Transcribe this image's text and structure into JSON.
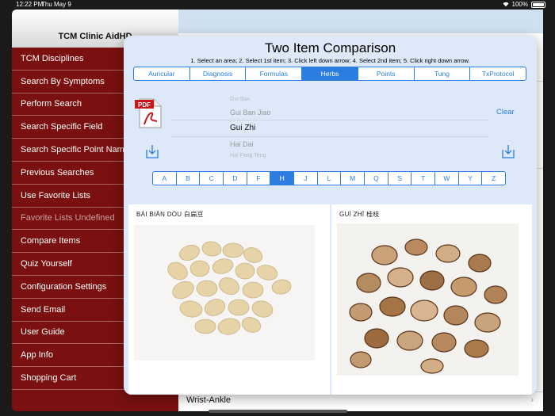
{
  "status_bar": {
    "time": "12:22 PM",
    "date": "Thu May 9",
    "battery": "100%"
  },
  "sidebar": {
    "title": "TCM Clinic AidHD",
    "items": [
      {
        "label": "TCM Disciplines",
        "enabled": true
      },
      {
        "label": "Search By Symptoms",
        "enabled": true
      },
      {
        "label": "Perform Search",
        "enabled": true
      },
      {
        "label": "Search Specific Field",
        "enabled": true
      },
      {
        "label": "Search Specific Point Nam",
        "enabled": true
      },
      {
        "label": "Previous Searches",
        "enabled": true
      },
      {
        "label": "Use Favorite Lists",
        "enabled": true
      },
      {
        "label": "Favorite Lists Undefined",
        "enabled": false
      },
      {
        "label": "Compare Items",
        "enabled": true
      },
      {
        "label": "Quiz Yourself",
        "enabled": true
      },
      {
        "label": "Configuration Settings",
        "enabled": true
      },
      {
        "label": "Send Email",
        "enabled": true
      },
      {
        "label": "User Guide",
        "enabled": true
      },
      {
        "label": "App Info",
        "enabled": true
      },
      {
        "label": "Shopping Cart",
        "enabled": true
      }
    ]
  },
  "background_list": {
    "last_item": "Wrist-Ankle"
  },
  "modal": {
    "title": "Two Item Comparison",
    "instructions": "1. Select an area; 2. Select 1st item; 3. Click left down arrow; 4. Select 2nd item; 5. Click right down arrow.",
    "tabs": [
      "Auricular",
      "Diagnosis",
      "Formulas",
      "Herbs",
      "Points",
      "Tung",
      "TxProtocol"
    ],
    "active_tab": "Herbs",
    "picker": {
      "items": [
        "Gui Ban",
        "Gui Ban Jiao",
        "Gui Zhi",
        "Hai Dai",
        "Hai Feng Teng"
      ],
      "selected": "Gui Zhi"
    },
    "clear_label": "Clear",
    "letters": [
      "A",
      "B",
      "C",
      "D",
      "F",
      "H",
      "J",
      "L",
      "M",
      "Q",
      "S",
      "T",
      "W",
      "Y",
      "Z"
    ],
    "active_letter": "H",
    "left_item": {
      "label": "BÁI BIĀN DÒU   白扁豆"
    },
    "right_item": {
      "label": "GUÌ ZHĪ   桂枝"
    }
  },
  "colors": {
    "accent": "#2b7de0",
    "sidebar_bg": "#7a1010",
    "modal_bg": "#dde8f8"
  },
  "icons": [
    "pdf-icon",
    "download-left-icon",
    "download-right-icon",
    "wifi-icon",
    "battery-icon",
    "chevron-right-icon"
  ]
}
